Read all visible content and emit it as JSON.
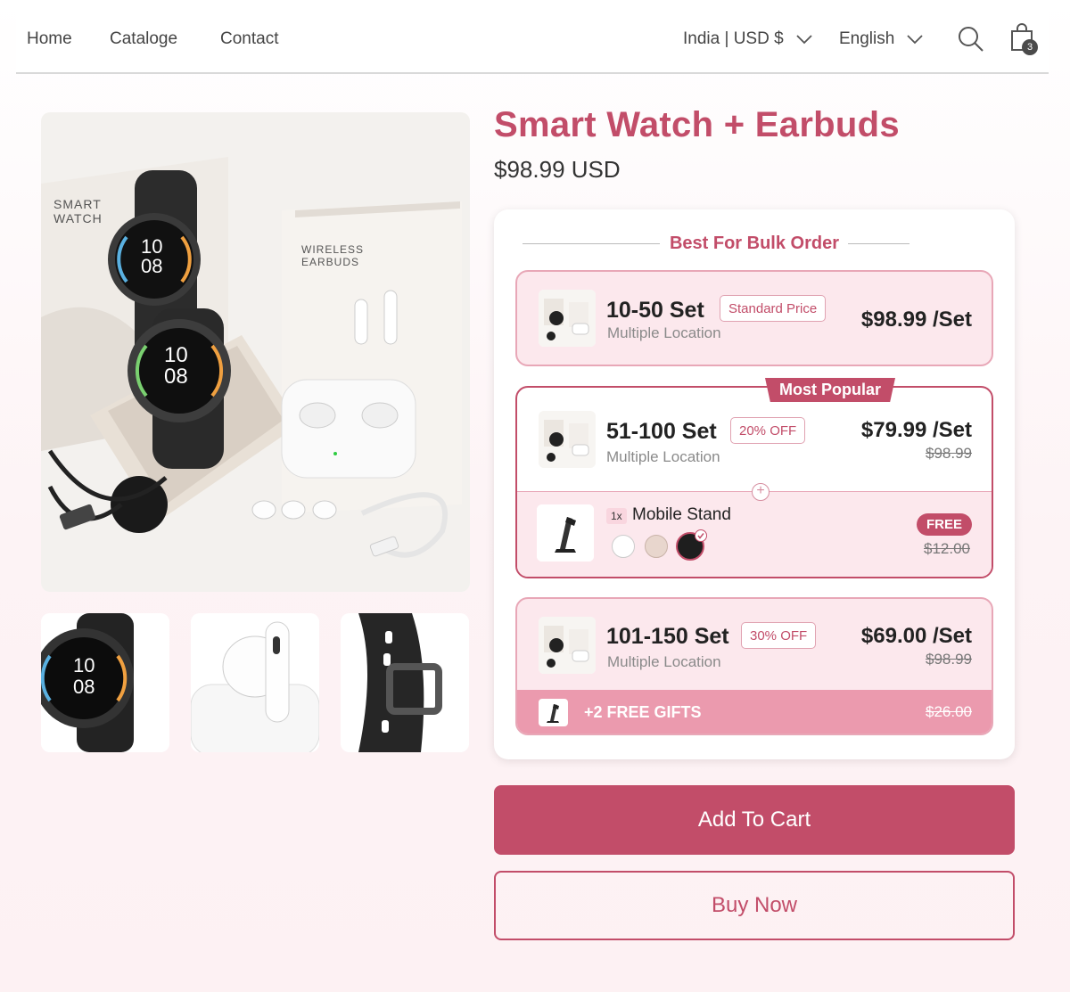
{
  "nav": {
    "links": [
      "Home",
      "Cataloge",
      "Contact"
    ],
    "currency": "India | USD $",
    "language": "English",
    "cart_count": "3"
  },
  "gallery": {
    "main_image": "smart-watch-earbuds-bundle-photo",
    "box_watch_text": "SMART WATCH",
    "box_earbuds_text": "WIRELESS EARBUDS",
    "watch_time_hour": "10",
    "watch_time_min": "08",
    "thumbnails": [
      "smartwatch-face-photo",
      "earbuds-case-photo",
      "watch-strap-photo"
    ]
  },
  "product": {
    "title": "Smart Watch + Earbuds",
    "price": "$98.99 USD"
  },
  "bulk": {
    "heading": "Best For Bulk Order",
    "tiers": [
      {
        "qty": "10-50 Set",
        "tag": "Standard Price",
        "location": "Multiple Location",
        "price": "$98.99 /Set"
      },
      {
        "qty": "51-100 Set",
        "tag": "20% OFF",
        "location": "Multiple Location",
        "price": "$79.99 /Set",
        "old_price": "$98.99",
        "badge": "Most Popular",
        "gift": {
          "qty": "1x",
          "name": "Mobile Stand",
          "badge": "FREE",
          "old_price": "$12.00",
          "swatches": [
            "#ffffff",
            "#e8d6cd",
            "#1e1e1e"
          ]
        }
      },
      {
        "qty": "101-150 Set",
        "tag": "30% OFF",
        "location": "Multiple Location",
        "price": "$69.00 /Set",
        "old_price": "$98.99",
        "free_gifts_label": "+2 FREE GIFTS",
        "free_gifts_old": "$26.00"
      }
    ]
  },
  "actions": {
    "add_to_cart": "Add To Cart",
    "buy_now": "Buy Now"
  },
  "colors": {
    "accent": "#c24d69",
    "accent_light": "#fce8ed",
    "accent_border": "#e8a7b7"
  }
}
